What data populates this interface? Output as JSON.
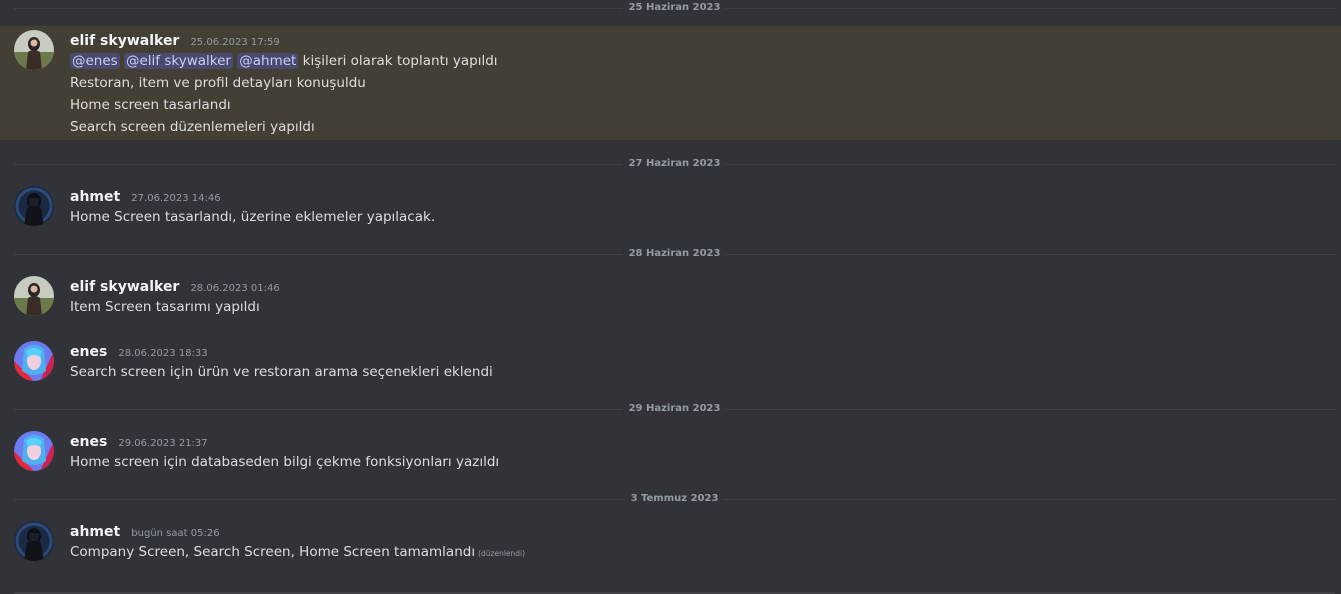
{
  "colors": {
    "background": "#313338",
    "highlight": "#443f35",
    "mention_bg": "#3c4270",
    "mention_text": "#c9cdfb"
  },
  "dividers": [
    "25 Haziran 2023",
    "27 Haziran 2023",
    "28 Haziran 2023",
    "29 Haziran 2023",
    "3 Temmuz 2023"
  ],
  "messages": [
    {
      "avatar": "elif-avatar",
      "username": "elif skywalker",
      "timestamp": "25.06.2023 17:59",
      "mentions": [
        "@enes",
        "@elif skywalker",
        "@ahmet"
      ],
      "mention_suffix": "kişileri olarak toplantı yapıldı",
      "lines": [
        "Restoran, item ve profil detayları konuşuldu",
        "Home screen tasarlandı",
        "Search screen düzenlemeleri yapıldı"
      ]
    },
    {
      "avatar": "ahmet-avatar",
      "username": "ahmet",
      "timestamp": "27.06.2023 14:46",
      "lines": [
        "Home Screen tasarlandı, üzerine eklemeler yapılacak."
      ]
    },
    {
      "avatar": "elif-avatar",
      "username": "elif skywalker",
      "timestamp": "28.06.2023 01:46",
      "lines": [
        "Item Screen tasarımı yapıldı"
      ]
    },
    {
      "avatar": "enes-avatar",
      "username": "enes",
      "timestamp": "28.06.2023 18:33",
      "lines": [
        "Search screen için ürün ve restoran arama seçenekleri eklendi"
      ]
    },
    {
      "avatar": "enes-avatar",
      "username": "enes",
      "timestamp": "29.06.2023 21:37",
      "lines": [
        "Home screen için databaseden bilgi çekme fonksiyonları yazıldı"
      ]
    },
    {
      "avatar": "ahmet-avatar",
      "username": "ahmet",
      "timestamp": "bugün saat 05:26",
      "lines": [
        "Company Screen, Search Screen, Home Screen tamamlandı"
      ],
      "edited_label": "(düzenlendi)"
    }
  ]
}
